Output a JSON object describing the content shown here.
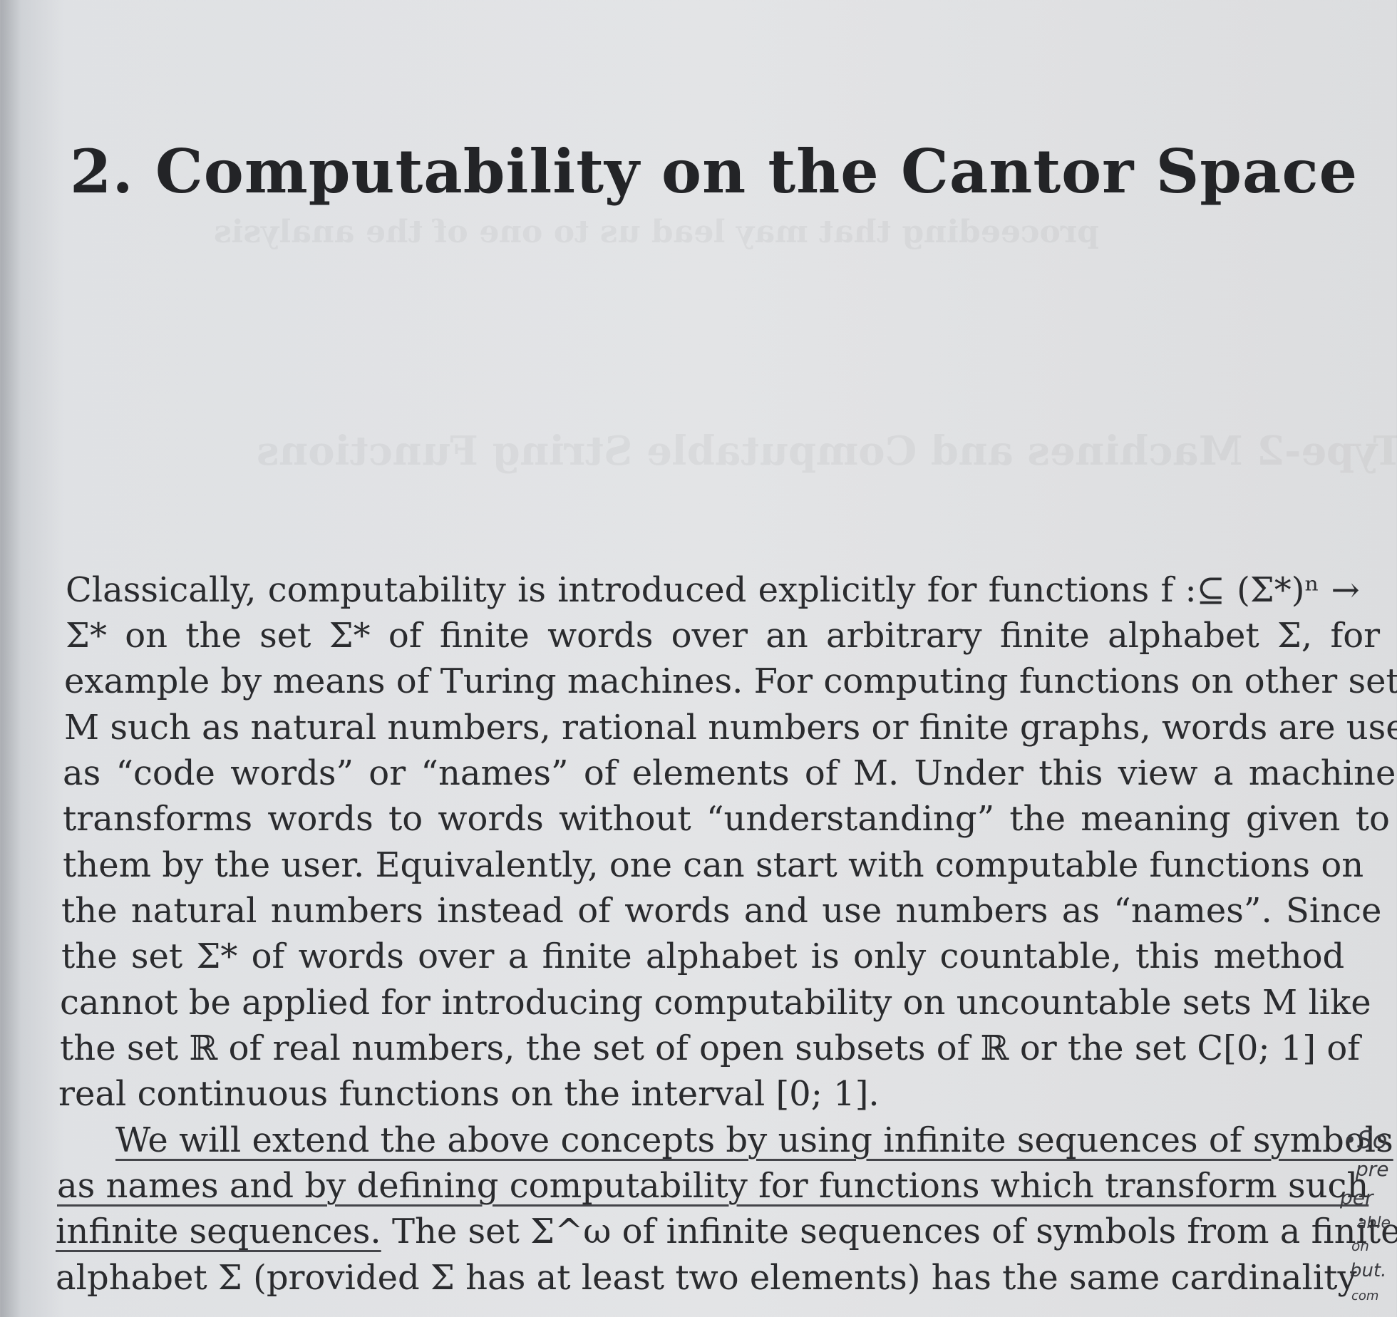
{
  "page": {
    "title": "2. Computability on the Cantor Space",
    "lines": [
      "Classically, computability is introduced explicitly for functions f :⊆ (Σ*)ⁿ →",
      "Σ* on the set Σ* of finite words over an arbitrary finite alphabet Σ, for",
      "example by means of Turing machines. For computing functions on other sets",
      "M such as natural numbers, rational numbers or finite graphs, words are used",
      "as “code words” or “names” of elements of M. Under this view a machine",
      "transforms words to words without “understanding” the meaning given to",
      "them by the user. Equivalently, one can start with computable functions on",
      "the natural numbers instead of words and use numbers as “names”. Since",
      "the set Σ* of words over a finite alphabet is only countable, this method",
      "cannot be applied for introducing computability on uncountable sets M like",
      "the set ℝ of real numbers, the set of open subsets of ℝ or the set C[0; 1] of",
      "real continuous functions on the interval [0; 1].",
      "We will extend the above concepts by using infinite sequences of symbols",
      "as names and by defining computability for functions which transform such",
      "infinite sequences. The set Σ^ω of infinite sequences of symbols from a finite",
      "alphabet Σ (provided Σ has at least two elements) has the same cardinality"
    ],
    "line14_underlined": "infinite sequences.",
    "line14_rest": " The set Σ^ω of infinite sequences of symbols from a finite",
    "margin_notes": [
      "•So",
      "pre",
      "per",
      "able",
      "on",
      "but.",
      "com"
    ]
  }
}
